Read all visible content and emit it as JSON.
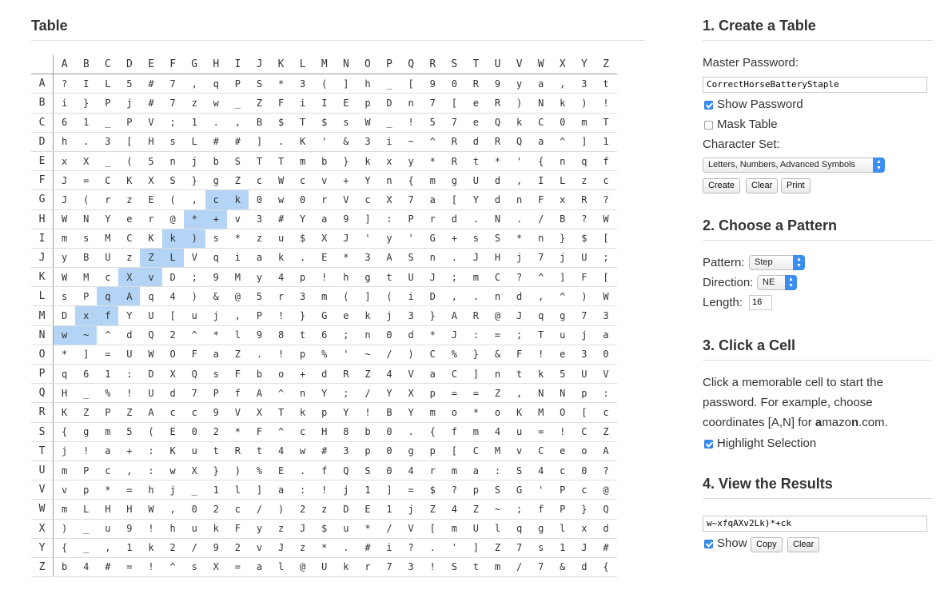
{
  "table": {
    "title": "Table",
    "columns": [
      "A",
      "B",
      "C",
      "D",
      "E",
      "F",
      "G",
      "H",
      "I",
      "J",
      "K",
      "L",
      "M",
      "N",
      "O",
      "P",
      "Q",
      "R",
      "S",
      "T",
      "U",
      "V",
      "W",
      "X",
      "Y",
      "Z"
    ],
    "rows": [
      {
        "label": "A",
        "cells": [
          "?",
          "I",
          "L",
          "5",
          "#",
          "7",
          ",",
          "q",
          "P",
          "S",
          "*",
          "3",
          "(",
          "]",
          "h",
          "_",
          "[",
          "9",
          "0",
          "R",
          "9",
          "y",
          "a",
          ",",
          "3",
          "t"
        ]
      },
      {
        "label": "B",
        "cells": [
          "i",
          "}",
          "P",
          "j",
          "#",
          "7",
          "z",
          "w",
          "_",
          "Z",
          "F",
          "i",
          "I",
          "E",
          "p",
          "D",
          "n",
          "7",
          "[",
          "e",
          "R",
          ")",
          "N",
          "k",
          ")",
          "!"
        ]
      },
      {
        "label": "C",
        "cells": [
          "6",
          "1",
          "_",
          "P",
          "V",
          ";",
          "1",
          ".",
          ",",
          "B",
          "$",
          "T",
          "$",
          "s",
          "W",
          "_",
          "!",
          "5",
          "7",
          "e",
          "Q",
          "k",
          "C",
          "0",
          "m",
          "T"
        ]
      },
      {
        "label": "D",
        "cells": [
          "h",
          ".",
          "3",
          "[",
          "H",
          "s",
          "L",
          "#",
          "#",
          "]",
          ".",
          "K",
          "'",
          "&",
          "3",
          "i",
          "~",
          "^",
          "R",
          "d",
          "R",
          "Q",
          "a",
          "^",
          "]",
          "1"
        ]
      },
      {
        "label": "E",
        "cells": [
          "x",
          "X",
          "_",
          "(",
          "5",
          "n",
          "j",
          "b",
          "S",
          "T",
          "T",
          "m",
          "b",
          "}",
          "k",
          "x",
          "y",
          "*",
          "R",
          "t",
          "*",
          "'",
          "{",
          "n",
          "q",
          "f"
        ]
      },
      {
        "label": "F",
        "cells": [
          "J",
          "=",
          "C",
          "K",
          "X",
          "S",
          "}",
          "g",
          "Z",
          "c",
          "W",
          "c",
          "v",
          "+",
          "Y",
          "n",
          "{",
          "m",
          "g",
          "U",
          "d",
          ",",
          "I",
          "L",
          "z",
          "c"
        ]
      },
      {
        "label": "G",
        "cells": [
          "J",
          "(",
          "r",
          "z",
          "E",
          "(",
          ",",
          "c",
          "k",
          "0",
          "w",
          "0",
          "r",
          "V",
          "c",
          "X",
          "7",
          "a",
          "[",
          "Y",
          "d",
          "n",
          "F",
          "x",
          "R",
          "?"
        ]
      },
      {
        "label": "H",
        "cells": [
          "W",
          "N",
          "Y",
          "e",
          "r",
          "@",
          "*",
          "+",
          "v",
          "3",
          "#",
          "Y",
          "a",
          "9",
          "]",
          ":",
          "P",
          "r",
          "d",
          ".",
          "N",
          ".",
          "/",
          "B",
          "?",
          "W"
        ]
      },
      {
        "label": "I",
        "cells": [
          "m",
          "s",
          "M",
          "C",
          "K",
          "k",
          ")",
          "s",
          "*",
          "z",
          "u",
          "$",
          "X",
          "J",
          "'",
          "y",
          "'",
          "G",
          "+",
          "s",
          "S",
          "*",
          "n",
          "}",
          "$",
          "["
        ]
      },
      {
        "label": "J",
        "cells": [
          "y",
          "B",
          "U",
          "z",
          "Z",
          "L",
          "V",
          "q",
          "i",
          "a",
          "k",
          ".",
          "E",
          "*",
          "3",
          "A",
          "S",
          "n",
          ".",
          "J",
          "H",
          "j",
          "7",
          "j",
          "U",
          ";"
        ]
      },
      {
        "label": "K",
        "cells": [
          "W",
          "M",
          "c",
          "X",
          "v",
          "D",
          ";",
          "9",
          "M",
          "y",
          "4",
          "p",
          "!",
          "h",
          "g",
          "t",
          "U",
          "J",
          ";",
          "m",
          "C",
          "?",
          "^",
          "]",
          "F",
          "["
        ]
      },
      {
        "label": "L",
        "cells": [
          "s",
          "P",
          "q",
          "A",
          "q",
          "4",
          ")",
          "&",
          "@",
          "5",
          "r",
          "3",
          "m",
          "(",
          "]",
          "(",
          "i",
          "D",
          ",",
          ".",
          "n",
          "d",
          ",",
          "^",
          ")",
          "W"
        ]
      },
      {
        "label": "M",
        "cells": [
          "D",
          "x",
          "f",
          "Y",
          "U",
          "[",
          "u",
          "j",
          ",",
          "P",
          "!",
          "}",
          "G",
          "e",
          "k",
          "j",
          "3",
          "}",
          "A",
          "R",
          "@",
          "J",
          "q",
          "g",
          "7",
          "3"
        ]
      },
      {
        "label": "N",
        "cells": [
          "w",
          "~",
          "^",
          "d",
          "Q",
          "2",
          "^",
          "*",
          "l",
          "9",
          "8",
          "t",
          "6",
          ";",
          "n",
          "0",
          "d",
          "*",
          "J",
          ":",
          "=",
          ";",
          "T",
          "u",
          "j",
          "a"
        ]
      },
      {
        "label": "O",
        "cells": [
          "*",
          "]",
          "=",
          "U",
          "W",
          "O",
          "F",
          "a",
          "Z",
          ".",
          "!",
          "p",
          "%",
          "'",
          "~",
          "/",
          ")",
          "C",
          "%",
          "}",
          "&",
          "F",
          "!",
          "e",
          "3",
          "0"
        ]
      },
      {
        "label": "P",
        "cells": [
          "q",
          "6",
          "1",
          ":",
          "D",
          "X",
          "Q",
          "s",
          "F",
          "b",
          "o",
          "+",
          "d",
          "R",
          "Z",
          "4",
          "V",
          "a",
          "C",
          "]",
          "n",
          "t",
          "k",
          "5",
          "U",
          "V"
        ]
      },
      {
        "label": "Q",
        "cells": [
          "H",
          "_",
          "%",
          "!",
          "U",
          "d",
          "7",
          "P",
          "f",
          "A",
          "^",
          "n",
          "Y",
          ";",
          "/",
          "Y",
          "X",
          "p",
          "=",
          "=",
          "Z",
          ",",
          "N",
          "N",
          "p",
          ":"
        ]
      },
      {
        "label": "R",
        "cells": [
          "K",
          "Z",
          "P",
          "Z",
          "A",
          "c",
          "c",
          "9",
          "V",
          "X",
          "T",
          "k",
          "p",
          "Y",
          "!",
          "B",
          "Y",
          "m",
          "o",
          "*",
          "o",
          "K",
          "M",
          "O",
          "[",
          "c"
        ]
      },
      {
        "label": "S",
        "cells": [
          "{",
          "g",
          "m",
          "5",
          "(",
          "E",
          "0",
          "2",
          "*",
          "F",
          "^",
          "c",
          "H",
          "8",
          "b",
          "0",
          ".",
          "{",
          "f",
          "m",
          "4",
          "u",
          "=",
          "!",
          "C",
          "Z"
        ]
      },
      {
        "label": "T",
        "cells": [
          "j",
          "!",
          "a",
          "+",
          ":",
          "K",
          "u",
          "t",
          "R",
          "t",
          "4",
          "w",
          "#",
          "3",
          "p",
          "0",
          "g",
          "p",
          "[",
          "C",
          "M",
          "v",
          "C",
          "e",
          "o",
          "A"
        ]
      },
      {
        "label": "U",
        "cells": [
          "m",
          "P",
          "c",
          ",",
          ":",
          "w",
          "X",
          "}",
          ")",
          "%",
          "E",
          ".",
          "f",
          "Q",
          "S",
          "0",
          "4",
          "r",
          "m",
          "a",
          ":",
          "S",
          "4",
          "c",
          "0",
          "?"
        ]
      },
      {
        "label": "V",
        "cells": [
          "v",
          "p",
          "*",
          "=",
          "h",
          "j",
          "_",
          "1",
          "l",
          "]",
          "a",
          ":",
          "!",
          "j",
          "1",
          "]",
          "=",
          "$",
          "?",
          "p",
          "S",
          "G",
          "'",
          "P",
          "c",
          "@"
        ]
      },
      {
        "label": "W",
        "cells": [
          "m",
          "L",
          "H",
          "H",
          "W",
          ",",
          "0",
          "2",
          "c",
          "/",
          ")",
          "2",
          "z",
          "D",
          "E",
          "1",
          "j",
          "Z",
          "4",
          "Z",
          "~",
          ";",
          "f",
          "P",
          "}",
          "Q"
        ]
      },
      {
        "label": "X",
        "cells": [
          ")",
          "_",
          "u",
          "9",
          "!",
          "h",
          "u",
          "k",
          "F",
          "y",
          "z",
          "J",
          "$",
          "u",
          "*",
          "/",
          "V",
          "[",
          "m",
          "U",
          "l",
          "q",
          "g",
          "l",
          "x",
          "d"
        ]
      },
      {
        "label": "Y",
        "cells": [
          "{",
          "_",
          ",",
          "1",
          "k",
          "2",
          "/",
          "9",
          "2",
          "v",
          "J",
          "z",
          "*",
          ".",
          "#",
          "i",
          "?",
          ".",
          "'",
          "]",
          "Z",
          "7",
          "s",
          "1",
          "J",
          "#"
        ]
      },
      {
        "label": "Z",
        "cells": [
          "b",
          "4",
          "#",
          "=",
          "!",
          "^",
          "s",
          "X",
          "=",
          "a",
          "l",
          "@",
          "U",
          "k",
          "r",
          "7",
          "3",
          "!",
          "S",
          "t",
          "m",
          "/",
          "7",
          "&",
          "d",
          "{"
        ]
      }
    ],
    "highlighted": [
      {
        "row": 13,
        "col": 0
      },
      {
        "row": 13,
        "col": 1
      },
      {
        "row": 12,
        "col": 1
      },
      {
        "row": 12,
        "col": 2
      },
      {
        "row": 11,
        "col": 2
      },
      {
        "row": 11,
        "col": 3
      },
      {
        "row": 10,
        "col": 3
      },
      {
        "row": 10,
        "col": 4
      },
      {
        "row": 9,
        "col": 4
      },
      {
        "row": 9,
        "col": 5
      },
      {
        "row": 8,
        "col": 5
      },
      {
        "row": 8,
        "col": 6
      },
      {
        "row": 7,
        "col": 6
      },
      {
        "row": 7,
        "col": 7
      },
      {
        "row": 6,
        "col": 7
      },
      {
        "row": 6,
        "col": 8
      }
    ],
    "highlight_color": "#b3d4f5"
  },
  "create": {
    "title": "1. Create a Table",
    "password_label": "Master Password:",
    "password_value": "CorrectHorseBatteryStaple",
    "show_password_label": "Show Password",
    "show_password_checked": true,
    "mask_table_label": "Mask Table",
    "mask_table_checked": false,
    "charset_label": "Character Set:",
    "charset_value": "Letters, Numbers, Advanced Symbols",
    "create_button": "Create",
    "clear_button": "Clear",
    "print_button": "Print"
  },
  "pattern": {
    "title": "2. Choose a Pattern",
    "pattern_label": "Pattern:",
    "pattern_value": "Step",
    "direction_label": "Direction:",
    "direction_value": "NE",
    "length_label": "Length:",
    "length_value": "16"
  },
  "click": {
    "title": "3. Click a Cell",
    "text_1": "Click a memorable cell to start the password. For example, choose coordinates [A,N] for ",
    "text_2": "a",
    "text_3": "mazo",
    "text_4": "n",
    "text_5": ".com.",
    "highlight_label": "Highlight Selection",
    "highlight_checked": true
  },
  "results": {
    "title": "4. View the Results",
    "result_value": "w~xfqAXv2Lk)*+ck",
    "show_label": "Show",
    "show_checked": true,
    "copy_button": "Copy",
    "clear_button": "Clear"
  },
  "accent_color": "#3b8df1"
}
